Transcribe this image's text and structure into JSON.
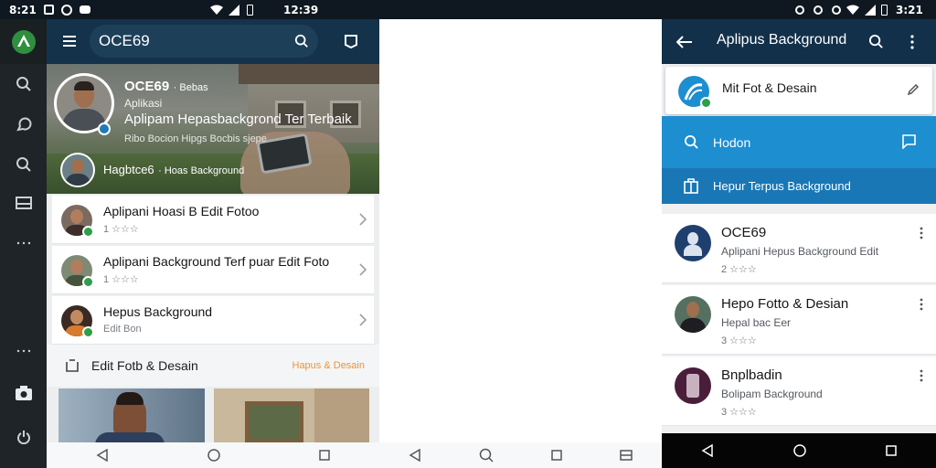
{
  "status_left": {
    "time": "8:21"
  },
  "status_mid": {
    "time": "12:39"
  },
  "status_right": {
    "time": "3:21"
  },
  "phone1": {
    "search_value": "OCE69",
    "hero": {
      "name": "OCE69",
      "name_extra": "· Bebas",
      "line2": "Aplikasi",
      "headline": "Aplipam Hepasbackgrond Ter Terbaik",
      "sub": "Ribo Bocion Hipgs Bocbis sjepe",
      "chip_title": "Hagbtce6",
      "chip_sub": "· Hoas Background"
    },
    "list": [
      {
        "title": "Aplipani Hoasi B Edit Fotoo",
        "sub": "1 ☆☆☆"
      },
      {
        "title": "Aplipani Background Terf puar Edit Foto",
        "sub": "1 ☆☆☆"
      },
      {
        "title": "Hepus Background",
        "sub": "Edit Bon"
      }
    ],
    "section": {
      "title": "Edit Fotb & Desain",
      "link": "Hapus & Desain"
    }
  },
  "phone3": {
    "title": "Aplipus Background",
    "top_card": {
      "title": "Mit Fot & Desain"
    },
    "search_label": "Hodon",
    "blue_row": "Hepur Terpus Background",
    "items": [
      {
        "title": "OCE69",
        "sub": "Aplipani Hepus Background Edit",
        "rating": "2 ☆☆☆"
      },
      {
        "title": "Hepo Fotto & Desian",
        "sub": "Hepal bac Eer",
        "rating": "3 ☆☆☆"
      },
      {
        "title": "Bnplbadin",
        "sub": "Bolipam Background",
        "rating": "3 ☆☆☆"
      }
    ]
  },
  "colors": {
    "statusbar": "#0f1820",
    "rail": "#1e2428",
    "appbar": "#14324a",
    "accent_blue": "#1d8ed0",
    "badge_green": "#2e9e4a",
    "link_orange": "#e8953a"
  }
}
